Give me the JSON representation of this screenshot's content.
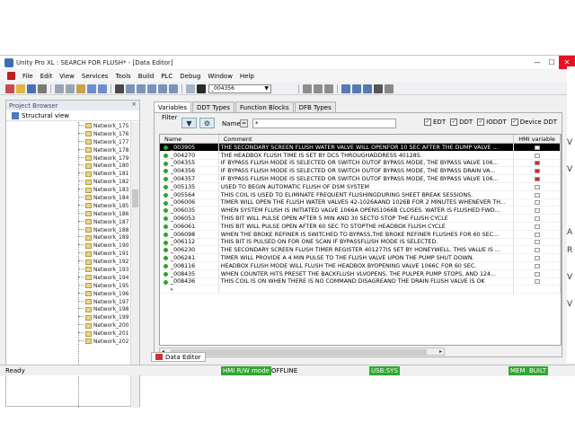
{
  "window": {
    "title": "Unity Pro XL : SEARCH FOR FLUSH* - [Data Editor]",
    "controls": {
      "minimize": "—",
      "maximize": "☐",
      "close": "✕"
    }
  },
  "menu": [
    "File",
    "Edit",
    "View",
    "Services",
    "Tools",
    "Build",
    "PLC",
    "Debug",
    "Window",
    "Help"
  ],
  "toolbar": {
    "combo_value": "_004356"
  },
  "browser": {
    "title": "Project Browser",
    "close": "×",
    "view_label": "Structural view",
    "items": [
      "Network_175",
      "Network_176",
      "Network_177",
      "Network_178",
      "Network_179",
      "Network_180",
      "Network_181",
      "Network_182",
      "Network_183",
      "Network_184",
      "Network_185",
      "Network_186",
      "Network_187",
      "Network_188",
      "Network_189",
      "Network_190",
      "Network_191",
      "Network_192",
      "Network_193",
      "Network_194",
      "Network_195",
      "Network_196",
      "Network_197",
      "Network_198",
      "Network_199",
      "Network_200",
      "Network_201",
      "Network_202"
    ]
  },
  "editor": {
    "tabs": [
      "Variables",
      "DDT Types",
      "Function Blocks",
      "DFB Types"
    ],
    "filter": {
      "label": "Filter",
      "name_label": "Name",
      "name_btn": "=",
      "name_value": "*",
      "checks": [
        {
          "label": "EDT",
          "checked": "✓"
        },
        {
          "label": "DDT",
          "checked": "✓"
        },
        {
          "label": "IODDT",
          "checked": "✓"
        },
        {
          "label": "Device DDT",
          "checked": "✓"
        }
      ]
    },
    "columns": {
      "name": "Name",
      "comment": "Comment",
      "hmi": "HMI variable"
    },
    "rows": [
      {
        "name": "_003905",
        "comment": "THE SECONDARY SCREEN FLUSH WATER VALVE WILL OPENFOR 10 SEC AFTER THE DUMP VALVE ...",
        "hmi": "plain"
      },
      {
        "name": "_004270",
        "comment": "THE HEADBOX FLUSH TIME IS SET BY DCS THROUGHADDRESS 401285.",
        "hmi": "plain"
      },
      {
        "name": "_004355",
        "comment": "IF BYPASS FLUSH MODE IS SELECTED OR SWITCH OUTOF BYPASS MODE, THE BYPASS VALVE 106...",
        "hmi": "red"
      },
      {
        "name": "_004356",
        "comment": "IF BYPASS FLUSH MODE IS SELECTED OR SWITCH OUTOF BYPASS MODE, THE BYPASS DRAIN VA...",
        "hmi": "red"
      },
      {
        "name": "_004357",
        "comment": "IF BYPASS FLUSH MODE IS SELECTED OR SWITCH OUTOF BYPASS MODE, THE BYPASS VALVE 106...",
        "hmi": "red"
      },
      {
        "name": "_005135",
        "comment": "USED TO BEGIN AUTOMATIC FLUSH OF DSM SYSTEM",
        "hmi": "plain"
      },
      {
        "name": "_005564",
        "comment": "THIS COIL IS USED TO ELIMINATE FREQUENT FLUSHINGDURING SHEET BREAK SESSIONS.",
        "hmi": "plain"
      },
      {
        "name": "_006006",
        "comment": "TIMER WILL OPEN THE FLUSH WATER VALVES 42-1026AAND 1026B FOR 2 MINUTES WHENEVER TH...",
        "hmi": "plain"
      },
      {
        "name": "_006035",
        "comment": "WHEN SYSTEM FLUSH IS INITIATED VALVE 1066A OPENS1066B CLOSES. WATER IS FLUSHED FWD...",
        "hmi": "plain"
      },
      {
        "name": "_006053",
        "comment": "THIS BIT WILL PULSE OPEN AFTER 5 MIN AND 30 SECTO STOP THE FLUSH CYCLE",
        "hmi": "plain"
      },
      {
        "name": "_006061",
        "comment": "THIS BIT WILL PULSE OPEN AFTER 60 SEC TO STOPTHE HEADBOX FLUSH CYCLE",
        "hmi": "plain"
      },
      {
        "name": "_006098",
        "comment": "WHEN THE BROKE REFINER IS SWITCHED TO BYPASS,THE BROKE REFINER FLUSHES FOR 60 SEC...",
        "hmi": "plain"
      },
      {
        "name": "_006112",
        "comment": "THIS BIT IS PULSED ON FOR ONE SCAN IF BYPASSFLUSH MODE IS SELECTED.",
        "hmi": "plain"
      },
      {
        "name": "_006230",
        "comment": "THE SECONDARY SCREEN FLUSH TIMER REGISTER 401277IS SET BY HONEYWELL. THIS VALUE IS ...",
        "hmi": "plain"
      },
      {
        "name": "_006241",
        "comment": "TIMER WILL PROVIDE A 4 MIN PULSE TO THE FLUSH VALVE UPON THE PUMP SHUT DOWN.",
        "hmi": "plain"
      },
      {
        "name": "_008116",
        "comment": "HEADBOX FLUSH MODE WILL FLUSH THE HEADBOX BYOPENING VALVE 1066C FOR 60 SEC.",
        "hmi": "plain"
      },
      {
        "name": "_008435",
        "comment": "WHEN COUNTER HITS PRESET THE BACKFLUSH VLVOPENS, THE PULPER PUMP STOPS, AND 124...",
        "hmi": "plain"
      },
      {
        "name": "_008436",
        "comment": "THIS COIL IS ON WHEN THERE IS NO COMMAND DISAGREAND THE DRAIN FLUSH VALVE IS OK",
        "hmi": "plain"
      }
    ],
    "new_row_marker": "▸"
  },
  "doc_tab": "Data Editor",
  "status": {
    "ready": "Ready",
    "hmi_mode": "HMI R/W mode",
    "offline": "OFFLINE",
    "usb": "USB:SYS",
    "mem": "MEM",
    "built": "BUILT"
  },
  "right_doc_chars": [
    "V",
    "V",
    "A",
    "R",
    "V",
    "V"
  ]
}
